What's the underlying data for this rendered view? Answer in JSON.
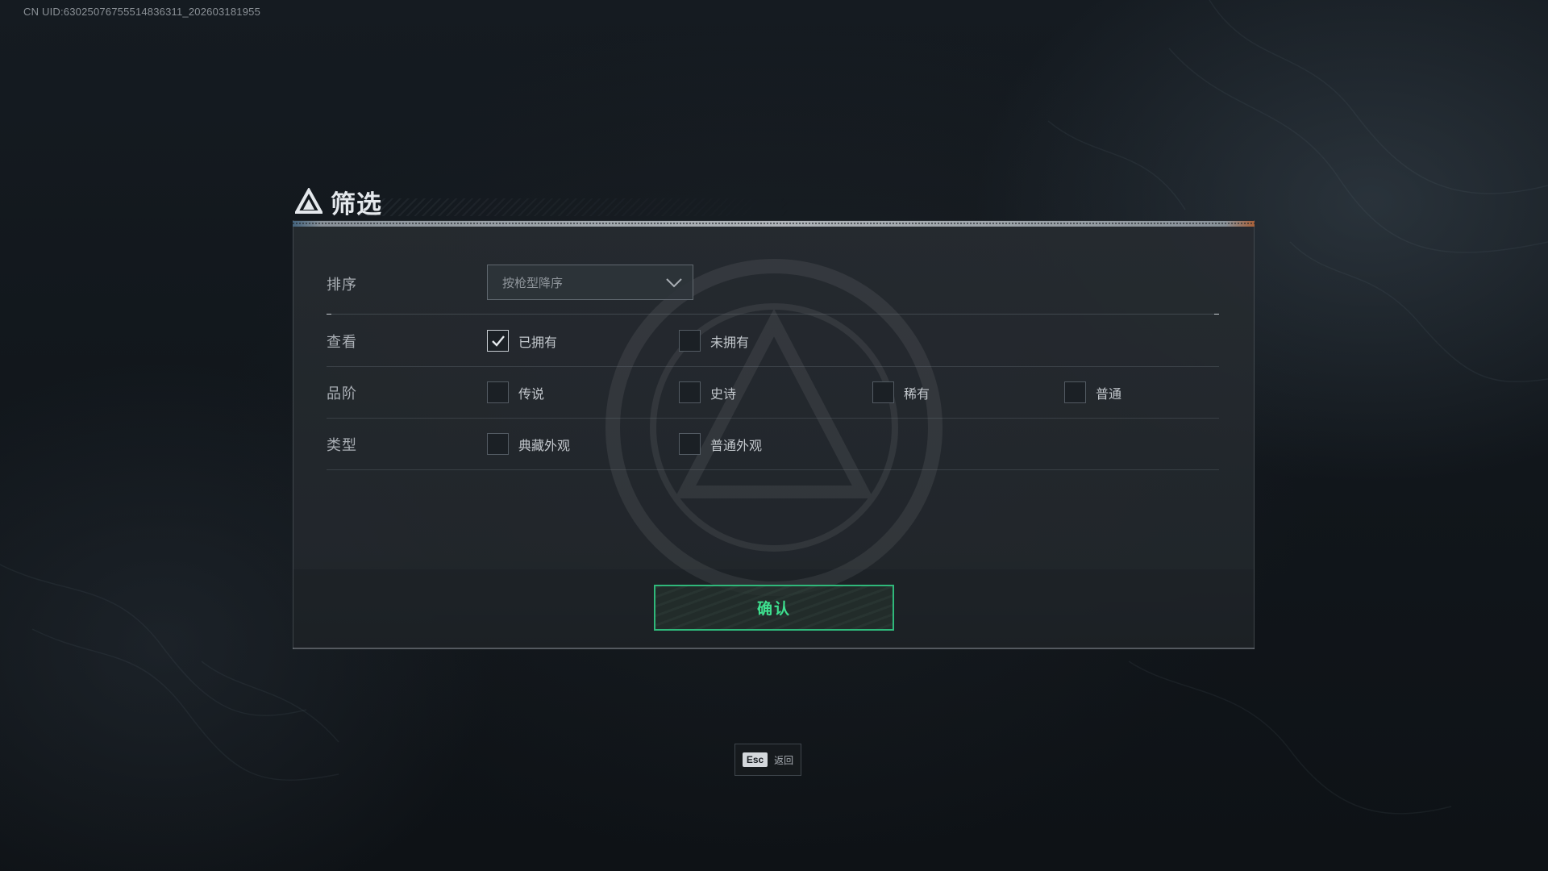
{
  "uid_text": "CN UID:63025076755514836311_202603181955",
  "dialog": {
    "title": "筛选",
    "title_icon": "triangle-logo-icon",
    "sort": {
      "label": "排序",
      "dropdown_value": "按枪型降序",
      "dropdown_icon": "chevron-down-icon"
    },
    "view": {
      "label": "查看",
      "options": [
        {
          "label": "已拥有",
          "checked": true
        },
        {
          "label": "未拥有",
          "checked": false
        }
      ]
    },
    "rarity": {
      "label": "品阶",
      "options": [
        {
          "label": "传说",
          "checked": false
        },
        {
          "label": "史诗",
          "checked": false
        },
        {
          "label": "稀有",
          "checked": false
        },
        {
          "label": "普通",
          "checked": false
        }
      ]
    },
    "type": {
      "label": "类型",
      "options": [
        {
          "label": "典藏外观",
          "checked": false
        },
        {
          "label": "普通外观",
          "checked": false
        }
      ]
    },
    "confirm_label": "确认"
  },
  "esc_hint": {
    "key": "Esc",
    "label": "返回"
  },
  "colors": {
    "accent_green": "#3ee08f",
    "confirm_border": "#2fb87a",
    "background": "#151b21",
    "panel": "#262b30"
  }
}
